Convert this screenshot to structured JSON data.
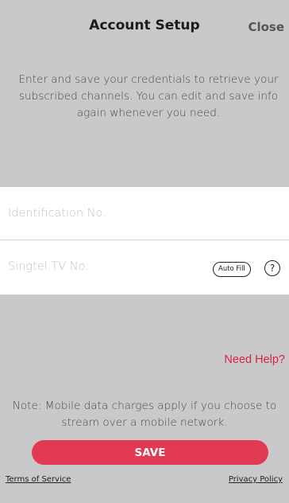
{
  "header": {
    "title": "Account Setup",
    "close_label": "Close"
  },
  "intro": {
    "text": "Enter and save your credentials to retrieve your subscribed channels. You can edit and save info again whenever you need."
  },
  "form": {
    "identification": {
      "value": "",
      "placeholder": "Identification No."
    },
    "singtel_tv": {
      "value": "",
      "placeholder": "Singtel TV No.",
      "autofill_label": "Auto Fill",
      "help_label": "?"
    }
  },
  "help_link": "Need Help?",
  "note": "Note: Mobile data charges apply if you choose to stream over a mobile network.",
  "save_label": "SAVE",
  "footer": {
    "terms_label": "Terms of Service",
    "privacy_label": "Privacy Policy"
  },
  "colors": {
    "accent": "#e23a53",
    "link_red": "#d72540",
    "background": "#c9c9cb"
  }
}
